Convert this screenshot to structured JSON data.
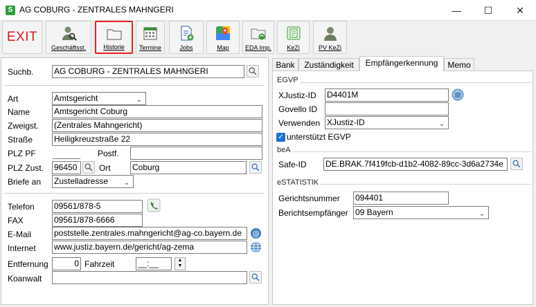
{
  "window": {
    "title": "AG COBURG - ZENTRALES MAHNGERI",
    "app_icon": "S",
    "minimize": "—",
    "maximize": "☐",
    "close": "✕"
  },
  "toolbar": {
    "exit": "EXIT",
    "geschaeftsst": "Geschäftsst.",
    "historie": "Historie",
    "termine": "Termine",
    "jobs": "Jobs",
    "map": "Map",
    "eda_imp": "EDA Imp.",
    "kezi": "KeZi",
    "pv_kezi": "PV KeZi"
  },
  "left": {
    "suchb_label": "Suchb.",
    "suchb_value": "AG COBURG - ZENTRALES MAHNGERI",
    "art_label": "Art",
    "art_value": "Amtsgericht",
    "name_label": "Name",
    "name_value": "Amtsgericht Coburg",
    "zweigst_label": "Zweigst.",
    "zweigst_value": "(Zentrales Mahngericht)",
    "strasse_label": "Straße",
    "strasse_value": "Heiligkreuzstraße 22",
    "plz_pf_label": "PLZ PF",
    "plz_pf_value": "",
    "postf_label": "Postf.",
    "postf_value": "",
    "plz_zust_label": "PLZ Zust.",
    "plz_zust_value": "96450",
    "ort_label": "Ort",
    "ort_value": "Coburg",
    "briefe_label": "Briefe an",
    "briefe_value": "Zustelladresse",
    "telefon_label": "Telefon",
    "telefon_value": "09561/878-5",
    "fax_label": "FAX",
    "fax_value": "09561/878-6666",
    "email_label": "E-Mail",
    "email_value": "poststelle.zentrales.mahngericht@ag-co.bayern.de",
    "internet_label": "Internet",
    "internet_value": "www.justiz.bayern.de/gericht/ag-zema",
    "entfernung_label": "Entfernung",
    "entfernung_value": "0",
    "fahrzeit_label": "Fahrzeit",
    "fahrzeit_value": "__:__",
    "koanwalt_label": "Koanwalt",
    "koanwalt_value": ""
  },
  "tabs": [
    "Bank",
    "Zuständigkeit",
    "Empfängerkennung",
    "Memo"
  ],
  "right": {
    "egvp_title": "EGVP",
    "xjustiz_id_label": "XJustiz-ID",
    "xjustiz_id_value": "D4401M",
    "govello_label": "Govello ID",
    "govello_value": "",
    "verwenden_label": "Verwenden",
    "verwenden_value": "XJustiz-ID",
    "egvp_check_label": "unterstützt EGVP",
    "bea_title": "beA",
    "safe_id_label": "Safe-ID",
    "safe_id_value": "DE.BRAK.7f419fcb-d1b2-4082-89cc-3d6a2734e",
    "estat_title": "eSTATISTIK",
    "gerichtsnummer_label": "Gerichtsnummer",
    "gerichtsnummer_value": "094401",
    "berichtsempf_label": "Berichtsempfänger",
    "berichtsempf_value": "09 Bayern"
  },
  "icons": {
    "search": "search-icon",
    "phone": "phone-icon",
    "email": "at-icon",
    "web": "globe-icon"
  },
  "colors": {
    "exit_red": "#d81c1c",
    "highlight_red": "#e2231a",
    "check_blue": "#1f6fd0"
  }
}
